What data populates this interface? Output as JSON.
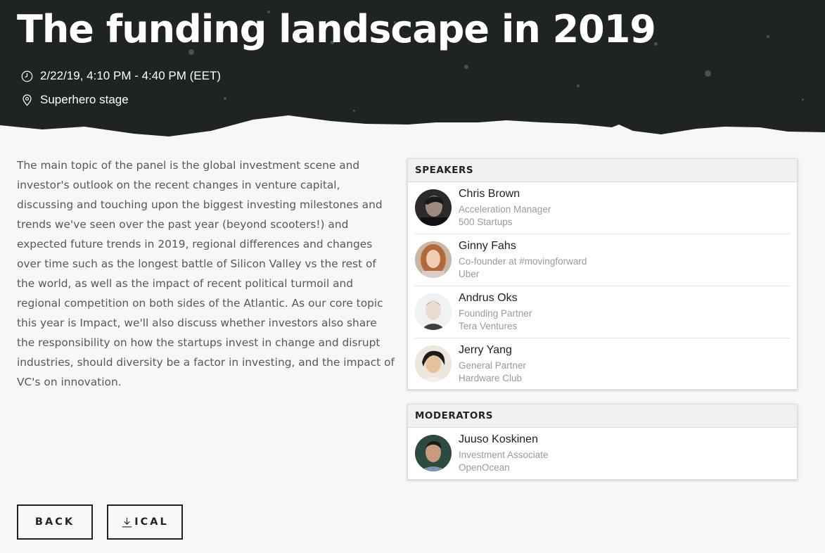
{
  "event": {
    "title": "The funding landscape in 2019",
    "time": "2/22/19, 4:10 PM - 4:40 PM (EET)",
    "location": "Superhero stage",
    "icons": {
      "time": "clock-icon",
      "location": "location-pin-icon"
    },
    "description": "The main topic of the panel is the global investment scene and investor's outlook on the recent changes in venture capital, discussing and touching upon the biggest investing milestones and trends we've seen over the past year (beyond scooters!) and expected future trends in 2019, regional differences and changes over time such as the longest battle of Silicon Valley vs the rest of the world, as well as the impact of recent political turmoil and regional competition on both sides of the Atlantic. As our core topic this year is Impact, we'll also discuss whether investors also share the responsibility on how the startups invest in change and disrupt industries, should diversity be a factor in investing, and the impact of VC's on innovation."
  },
  "speakers": {
    "heading": "SPEAKERS",
    "items": [
      {
        "name": "Chris Brown",
        "role": "Acceleration Manager",
        "company": "500 Startups"
      },
      {
        "name": "Ginny Fahs",
        "role": "Co-founder at #movingforward",
        "company": "Uber"
      },
      {
        "name": "Andrus Oks",
        "role": "Founding Partner",
        "company": "Tera Ventures"
      },
      {
        "name": "Jerry Yang",
        "role": "General Partner",
        "company": "Hardware Club"
      }
    ]
  },
  "moderators": {
    "heading": "MODERATORS",
    "items": [
      {
        "name": "Juuso Koskinen",
        "role": "Investment Associate",
        "company": "OpenOcean"
      }
    ]
  },
  "actions": {
    "back_label": "BACK",
    "ical_label": "ICAL",
    "ical_icon": "download-icon"
  },
  "colors": {
    "hero_background": "#1f2421",
    "page_background": "#f7f7f7",
    "muted_text": "#9a9a9a"
  }
}
